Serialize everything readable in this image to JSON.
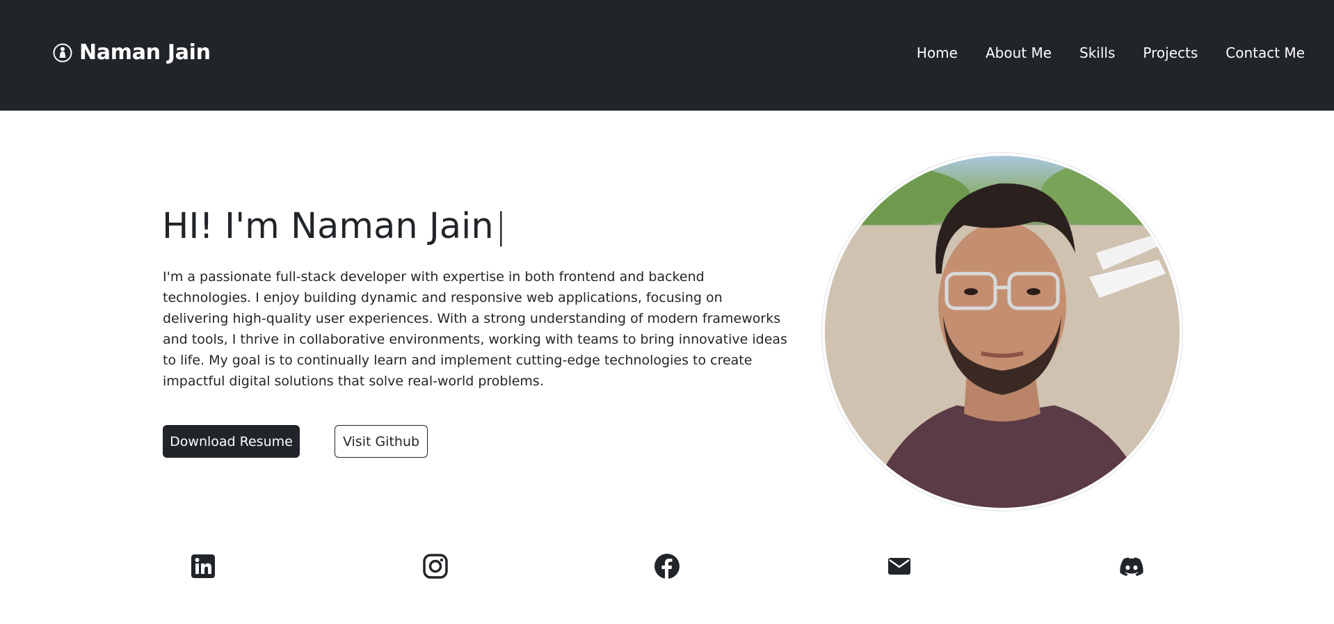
{
  "navbar": {
    "brand": "Naman Jain",
    "links": [
      "Home",
      "About Me",
      "Skills",
      "Projects",
      "Contact Me"
    ]
  },
  "hero": {
    "title": "HI! I'm Naman Jain",
    "cursor": "|",
    "description": "I'm a passionate full-stack developer with expertise in both frontend and backend technologies. I enjoy building dynamic and responsive web applications, focusing on delivering high-quality user experiences. With a strong understanding of modern frameworks and tools, I thrive in collaborative environments, working with teams to bring innovative ideas to life. My goal is to continually learn and implement cutting-edge technologies to create impactful digital solutions that solve real-world problems.",
    "primary_button": "Download Resume",
    "secondary_button": "Visit Github"
  },
  "socials": [
    {
      "icon": "linkedin-icon"
    },
    {
      "icon": "instagram-icon"
    },
    {
      "icon": "facebook-icon"
    },
    {
      "icon": "mail-icon"
    },
    {
      "icon": "discord-icon"
    }
  ],
  "colors": {
    "navbar_bg": "#212529",
    "text": "#212529",
    "button_dark": "#212529",
    "background": "#ffffff"
  }
}
